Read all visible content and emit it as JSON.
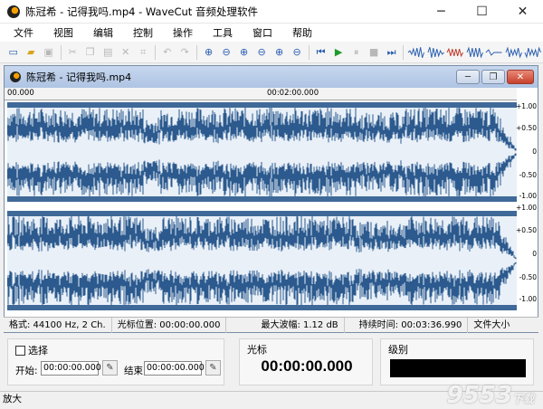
{
  "window": {
    "title": "陈冠希 - 记得我吗.mp4 - WaveCut 音频处理软件",
    "controls": [
      "─",
      "☐",
      "✕"
    ]
  },
  "menu": [
    "文件",
    "视图",
    "编辑",
    "控制",
    "操作",
    "工具",
    "窗口",
    "帮助"
  ],
  "child": {
    "title": "陈冠希 - 记得我吗.mp4"
  },
  "ruler": {
    "start": "00.000",
    "mid": "00:02:00.000"
  },
  "scale": [
    "+1.00",
    "+0.50",
    "0",
    "-0.50",
    "-1.00",
    "+1.00",
    "+0.50",
    "0",
    "-0.50",
    "-1.00"
  ],
  "status": {
    "format": "格式: 44100 Hz, 2 Ch.",
    "cursor": "光标位置: 00:00:00.000",
    "peak": "最大波幅: 1.12 dB",
    "duration": "持续时间: 00:03:36.990",
    "size": "文件大小"
  },
  "selection": {
    "label": "选择",
    "start_label": "开始:",
    "start_value": "00:00:00.000",
    "end_label": "结束:",
    "end_value": "00:00:00.000"
  },
  "cursor_group": {
    "title": "光标",
    "time": "00:00:00.000"
  },
  "level_group": {
    "title": "级别"
  },
  "bottom_status": "放大",
  "watermark": {
    "main": "9553",
    "sub": "下载"
  },
  "colors": {
    "wave": "#2c5a8e",
    "wave_bg": "#e9f0f8",
    "level": "#000000"
  }
}
